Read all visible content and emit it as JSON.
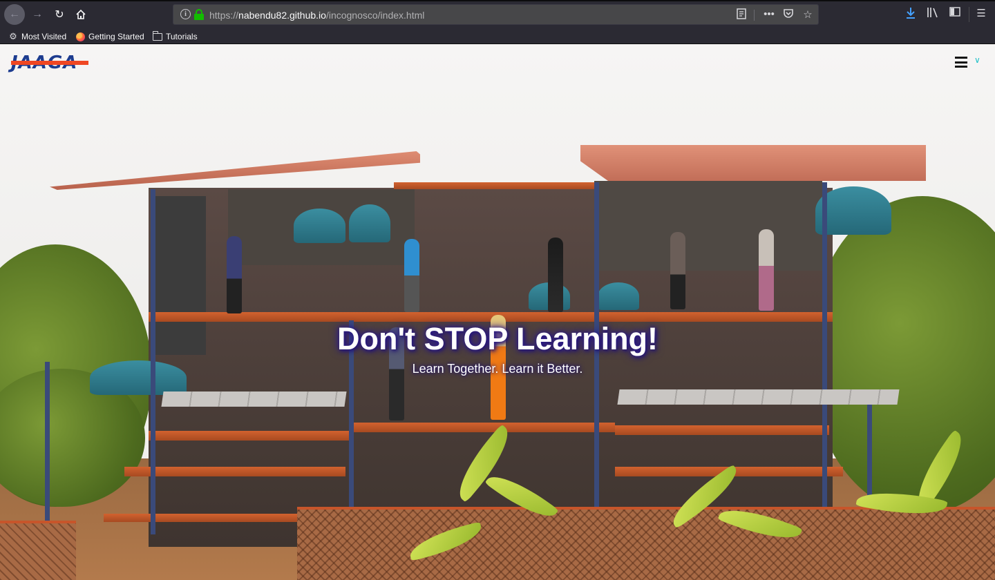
{
  "browser": {
    "url_prefix": "https://",
    "url_domain": "nabendu82.github.io",
    "url_path": "/incognosco/index.html",
    "accent_color": "#45a1ff",
    "secure_color": "#12bc00",
    "bookmarks": [
      {
        "label": "Most Visited",
        "icon": "gear-icon"
      },
      {
        "label": "Getting Started",
        "icon": "firefox-icon"
      },
      {
        "label": "Tutorials",
        "icon": "folder-icon"
      }
    ]
  },
  "site": {
    "logo_text": "JAAGA",
    "logo_colors": {
      "text": "#1d3c8f",
      "bar": "#ef4723"
    },
    "hero": {
      "title": "Don't STOP Learning!",
      "subtitle": "Learn Together. Learn it Better."
    }
  }
}
